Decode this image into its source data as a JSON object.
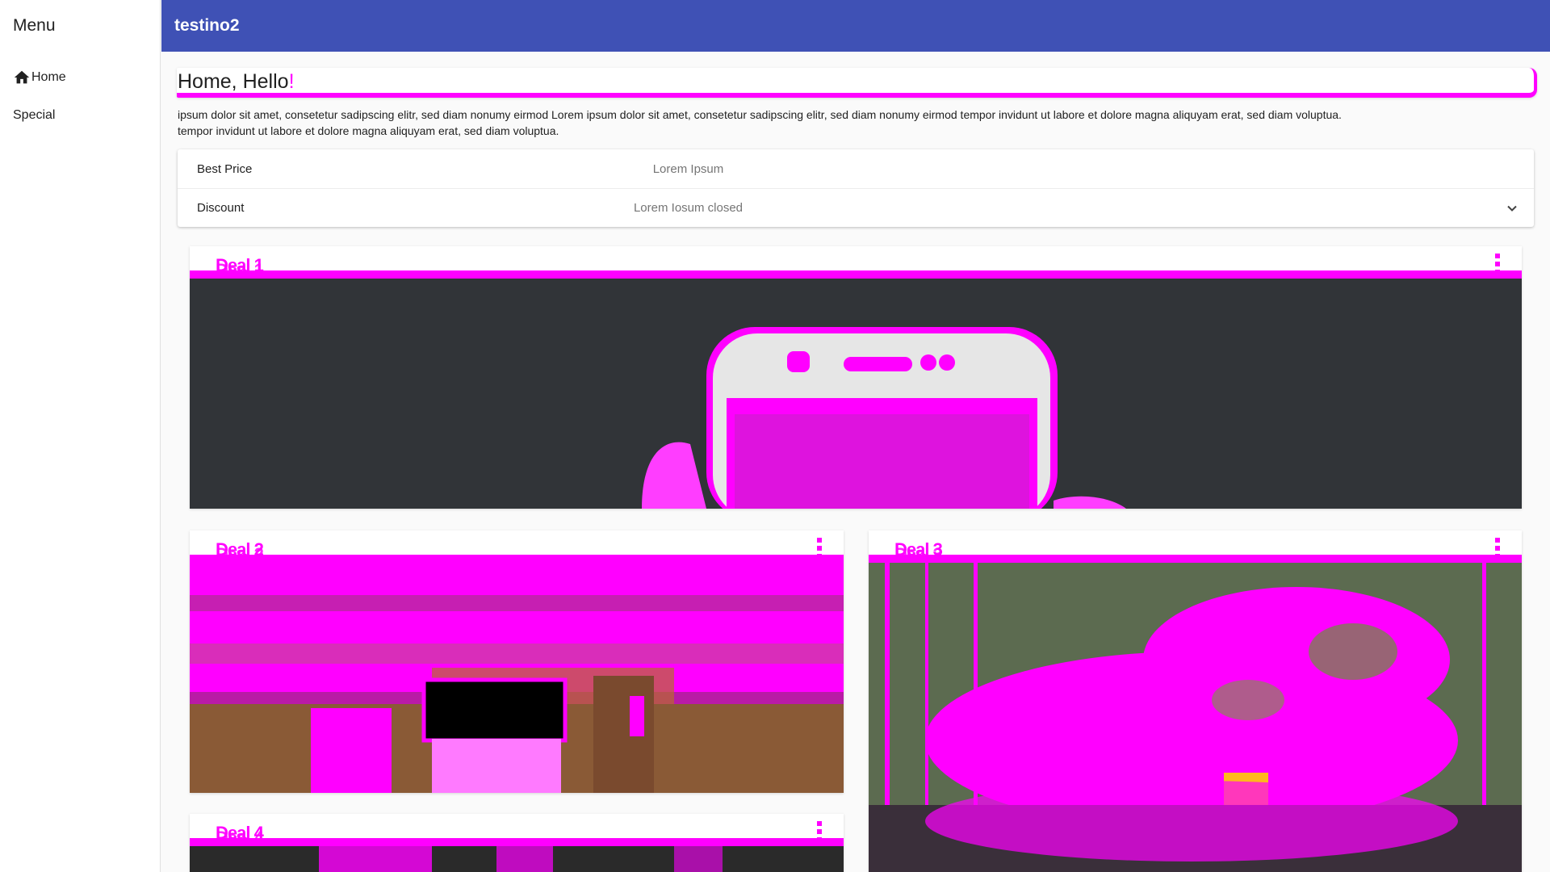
{
  "sidebar": {
    "title": "Menu",
    "items": [
      {
        "label": "Home",
        "icon": "home-icon"
      },
      {
        "label": "Special"
      }
    ]
  },
  "topbar": {
    "title": "testino2"
  },
  "greeting": {
    "text": "Home, Hello!",
    "mark": "!"
  },
  "intro": {
    "line1": "ipsum dolor sit amet, consetetur sadipscing elitr, sed diam nonumy eirmod Lorem ipsum dolor sit amet, consetetur sadipscing elitr, sed diam nonumy eirmod tempor invidunt ut labore et dolore magna aliquyam erat, sed diam voluptua.",
    "line2": "tempor invidunt ut labore et dolore magna aliquyam erat, sed diam voluptua."
  },
  "panels": [
    {
      "title": "Best Price",
      "description": "Lorem Ipsum"
    },
    {
      "title": "Discount",
      "description": "Lorem Iosum closed",
      "icon": "chevron-down-icon"
    }
  ],
  "cards": [
    {
      "title": "Deal 1",
      "image": "phone-in-hand-photo"
    },
    {
      "title": "Deal 2",
      "image": "laptop-on-wooden-table-photo"
    },
    {
      "title": "Deal 3",
      "image": "fruit-basket-photo"
    },
    {
      "title": "Deal 4",
      "image": "photo"
    }
  ],
  "colors": {
    "primary": "#3f51b5",
    "accent": "#ff00ff",
    "sidebar_bg": "#ffffff",
    "page_bg": "#fafafa"
  }
}
